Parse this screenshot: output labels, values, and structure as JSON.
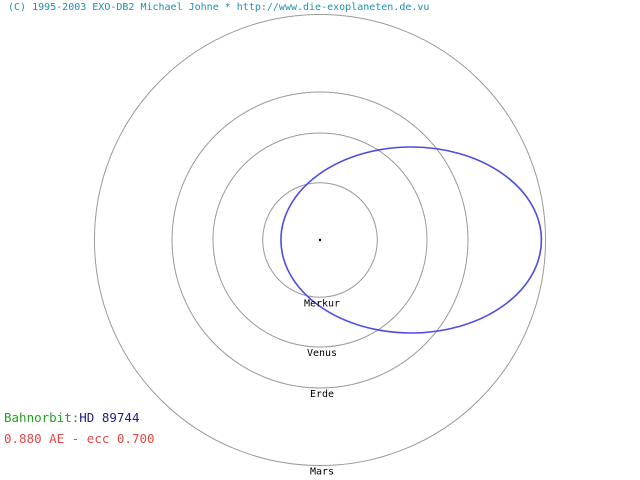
{
  "copyright": "(C) 1995-2003 EXO-DB2 Michael Johne * http://www.die-exoplaneten.de.vu",
  "orbit_label": "Bahnorbit:",
  "star_name": "HD 89744",
  "semi_major_axis_text": "0.880 AE",
  "separator": " - ",
  "eccentricity_text": "ecc 0.700",
  "semi_major_axis_au": 0.88,
  "eccentricity": 0.7,
  "planets": [
    {
      "name": "Merkur",
      "a_au": 0.387
    },
    {
      "name": "Venus",
      "a_au": 0.723
    },
    {
      "name": "Erde",
      "a_au": 1.0
    },
    {
      "name": "Mars",
      "a_au": 1.524
    }
  ],
  "colors": {
    "background": "#ffffff",
    "reference_orbits": "#9a9a9a",
    "planet_orbit": "#4b4be6",
    "star": "#000000",
    "copyright_text": "#1f8fb0",
    "orbit_label": "#22a022",
    "star_name": "#1d1d8c",
    "params_text": "#e04848",
    "planet_label": "#000000"
  }
}
